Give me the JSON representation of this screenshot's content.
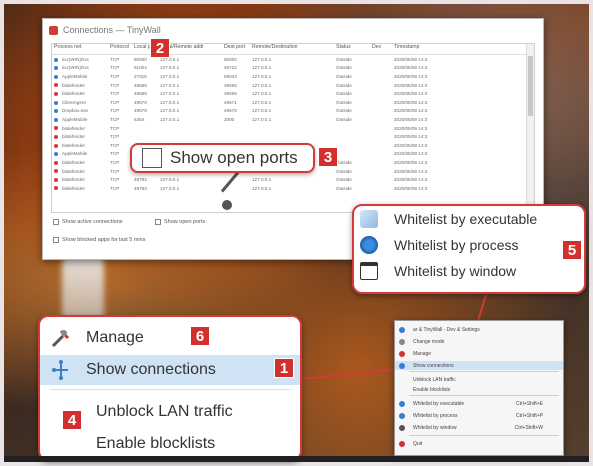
{
  "window": {
    "title": "Connections — TinyWall",
    "columns": [
      "Process net",
      "Protocol",
      "Local port",
      "Local/Remote addr",
      "Dest port",
      "Remote/Destination",
      "Status",
      "Dev",
      "Timestamp"
    ],
    "rows": [
      {
        "name": "svc(WIN)/svc",
        "proto": "TCP",
        "port": "80000",
        "addr": "127.0.0.1",
        "dport": "50000",
        "remote": "127.0.0.1",
        "state": "Outside",
        "time": "2020/05/09 14:3"
      },
      {
        "name": "svc(WIN)/svc",
        "proto": "TCP",
        "port": "51004",
        "addr": "127.0.0.1",
        "dport": "49722",
        "remote": "127.0.0.1",
        "state": "Outside",
        "time": "2020/05/09 14:3"
      },
      {
        "name": "AppleMobile",
        "proto": "TCP",
        "port": "27015",
        "addr": "127.0.0.1",
        "dport": "59043",
        "remote": "127.0.0.1",
        "state": "Outside",
        "time": "2020/05/09 14:3"
      },
      {
        "name": "bitdefender",
        "proto": "TCP",
        "port": "49669",
        "addr": "127.0.0.1",
        "dport": "49668",
        "remote": "127.0.0.1",
        "state": "Outside",
        "time": "2020/05/09 14:3"
      },
      {
        "name": "bitdefender",
        "proto": "TCP",
        "port": "49669",
        "addr": "127.0.0.1",
        "dport": "49669",
        "remote": "127.0.0.1",
        "state": "Outside",
        "time": "2020/05/09 14:3"
      },
      {
        "name": "ClientAgent",
        "proto": "TCP",
        "port": "49670",
        "addr": "127.0.0.1",
        "dport": "49671",
        "remote": "127.0.0.1",
        "state": "Outside",
        "time": "2020/05/09 14:3"
      },
      {
        "name": "Dropbox.exe",
        "proto": "TCP",
        "port": "49679",
        "addr": "127.0.0.1",
        "dport": "49678",
        "remote": "127.0.0.1",
        "state": "Outside",
        "time": "2020/05/09 14:3"
      },
      {
        "name": "AppleMobile",
        "proto": "TCP",
        "port": "5354",
        "addr": "127.0.0.1",
        "dport": "2000",
        "remote": "127.0.0.1",
        "state": "Outside",
        "time": "2020/05/09 14:3"
      },
      {
        "name": "bitdefender",
        "proto": "TCP",
        "port": "",
        "addr": "",
        "dport": "",
        "remote": "",
        "state": "",
        "time": "2020/05/09 14:3"
      },
      {
        "name": "bitdefender",
        "proto": "TCP",
        "port": "",
        "addr": "",
        "dport": "",
        "remote": "",
        "state": "",
        "time": "2020/05/09 14:3"
      },
      {
        "name": "bitdefender",
        "proto": "TCP",
        "port": "",
        "addr": "",
        "dport": "",
        "remote": "",
        "state": "",
        "time": "2020/05/09 14:3"
      },
      {
        "name": "AppleMobile",
        "proto": "TCP",
        "port": "",
        "addr": "",
        "dport": "",
        "remote": "",
        "state": "",
        "time": "2020/05/09 14:3"
      },
      {
        "name": "bitdefender",
        "proto": "TCP",
        "port": "",
        "addr": "",
        "dport": "",
        "remote": "",
        "state": "Outside",
        "time": "2020/05/09 14:3"
      },
      {
        "name": "bitdefender",
        "proto": "TCP",
        "port": "49780",
        "addr": "127.0.0.1",
        "dport": "",
        "remote": "127.0.0.1",
        "state": "Outside",
        "time": "2020/05/09 14:3"
      },
      {
        "name": "bitdefender",
        "proto": "TCP",
        "port": "49782",
        "addr": "127.0.0.1",
        "dport": "",
        "remote": "127.0.0.1",
        "state": "Outside",
        "time": "2020/05/09 14:3"
      },
      {
        "name": "bitdefender",
        "proto": "TCP",
        "port": "49783",
        "addr": "127.0.0.1",
        "dport": "",
        "remote": "127.0.0.1",
        "state": "Outside",
        "time": "2020/05/09 14:3"
      }
    ],
    "opt_active": "Show active connections",
    "opt_open": "Show open ports",
    "opt_blocked": "Show blocked apps for last 5 mins"
  },
  "callouts": {
    "show_open_ports": "Show open ports",
    "whitelist": [
      "Whitelist by executable",
      "Whitelist by process",
      "Whitelist by window"
    ],
    "menu": {
      "manage": "Manage",
      "show_connections": "Show connections",
      "unblock_lan": "Unblock LAN traffic",
      "enable_blocklists": "Enable blocklists"
    }
  },
  "badges": {
    "b1": "1",
    "b2": "2",
    "b3": "3",
    "b4": "4",
    "b5": "5",
    "b6": "6"
  },
  "context_menu": {
    "items": [
      {
        "label": "ar & TinyWall - Dev & Settings",
        "sc": ""
      },
      {
        "label": "Change mode",
        "sc": ""
      },
      {
        "label": "Manage",
        "sc": ""
      },
      {
        "label": "Show connections",
        "sc": ""
      },
      {
        "label": "Unblock LAN traffic",
        "sc": ""
      },
      {
        "label": "Enable blocklists",
        "sc": ""
      },
      {
        "label": "Whitelist by executable",
        "sc": "Ctrl+Shift+E"
      },
      {
        "label": "Whitelist by process",
        "sc": "Ctrl+Shift+P"
      },
      {
        "label": "Whitelist by window",
        "sc": "Ctrl+Shift+W"
      },
      {
        "label": "Quit",
        "sc": ""
      }
    ]
  },
  "colors": {
    "accent": "#d22f2f",
    "highlight": "#cfe3f5"
  }
}
